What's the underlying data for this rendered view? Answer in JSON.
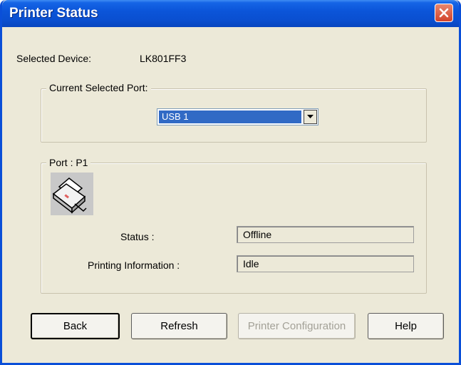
{
  "window": {
    "title": "Printer Status"
  },
  "device": {
    "label": "Selected Device:",
    "value": "LK801FF3"
  },
  "port_group": {
    "legend": "Current Selected Port:",
    "selected": "USB 1"
  },
  "port_box": {
    "legend": "Port : P1",
    "status_label": "Status :",
    "status_value": "Offline",
    "printing_label": "Printing Information :",
    "printing_value": "Idle"
  },
  "buttons": {
    "back": "Back",
    "refresh": "Refresh",
    "printer_configuration": "Printer Configuration",
    "help": "Help"
  },
  "icons": {
    "close": "close-icon",
    "printer": "printer-icon",
    "dropdown": "chevron-down-icon"
  }
}
